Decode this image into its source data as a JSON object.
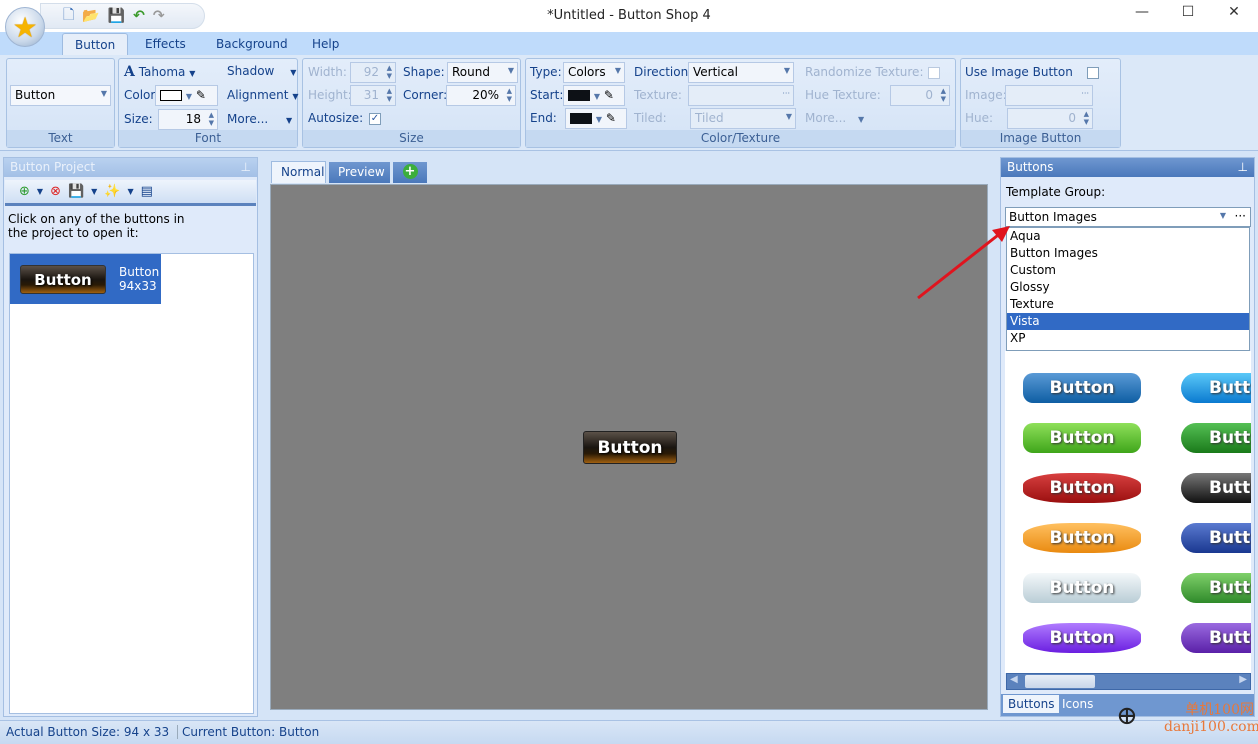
{
  "window": {
    "title": "*Untitled - Button Shop 4",
    "minimize": "—",
    "maximize": "☐",
    "close": "✕"
  },
  "quick_access": {
    "new": "🗋",
    "open": "📂",
    "save": "💾",
    "undo": "↶",
    "redo": "↷"
  },
  "ribbon_tabs": [
    "Button",
    "Effects",
    "Background",
    "Help"
  ],
  "ribbon": {
    "text": {
      "label": "Text",
      "value": "Button"
    },
    "font": {
      "label": "Font",
      "font_name": "Tahoma",
      "shadow": "Shadow",
      "color_label": "Color:",
      "color_value": "#ffffff",
      "alignment": "Alignment",
      "size_label": "Size:",
      "size": "18",
      "more": "More..."
    },
    "size": {
      "label": "Size",
      "width_label": "Width:",
      "width": "92",
      "height_label": "Height:",
      "height": "31",
      "shape_label": "Shape:",
      "shape": "Round",
      "corner_label": "Corner:",
      "corner": "20%",
      "autosize_label": "Autosize:",
      "autosize": true
    },
    "color_texture": {
      "label": "Color/Texture",
      "type_label": "Type:",
      "type": "Colors",
      "direction_label": "Direction:",
      "direction": "Vertical",
      "randomize_label": "Randomize Texture:",
      "start_label": "Start:",
      "start_color": "#0d1116",
      "texture_label": "Texture:",
      "hue_texture_label": "Hue Texture:",
      "hue_texture": "0",
      "end_label": "End:",
      "end_color": "#0d1116",
      "tiled_label": "Tiled:",
      "tiled": "Tiled",
      "more": "More..."
    },
    "image_button": {
      "label": "Image Button",
      "use_label": "Use Image Button",
      "image_label": "Image:",
      "hue_label": "Hue:",
      "hue": "0"
    }
  },
  "project_panel": {
    "title": "Button Project",
    "instruction": "Click on any of the buttons in the project to open it:",
    "items": [
      {
        "button_text": "Button",
        "name": "Button",
        "size": "94x33"
      }
    ]
  },
  "editor": {
    "tabs": [
      "Normal",
      "Preview"
    ],
    "add_tab": "+",
    "button_text": "Button"
  },
  "buttons_panel": {
    "title": "Buttons",
    "template_group_label": "Template Group:",
    "template_group": "Button Images",
    "options": [
      "Aqua",
      "Button Images",
      "Custom",
      "Glossy",
      "Texture",
      "Vista",
      "XP"
    ],
    "selected_option": "Vista",
    "gallery_text": "Button",
    "gallery_partial": "Butto",
    "bottom_tabs": [
      "Buttons",
      "Icons"
    ]
  },
  "status": {
    "actual_size_label": "Actual Button Size:",
    "actual_size": "94 x 33",
    "current_label": "Current Button:",
    "current": "Button"
  },
  "watermark": "单机100网 danji100.com"
}
